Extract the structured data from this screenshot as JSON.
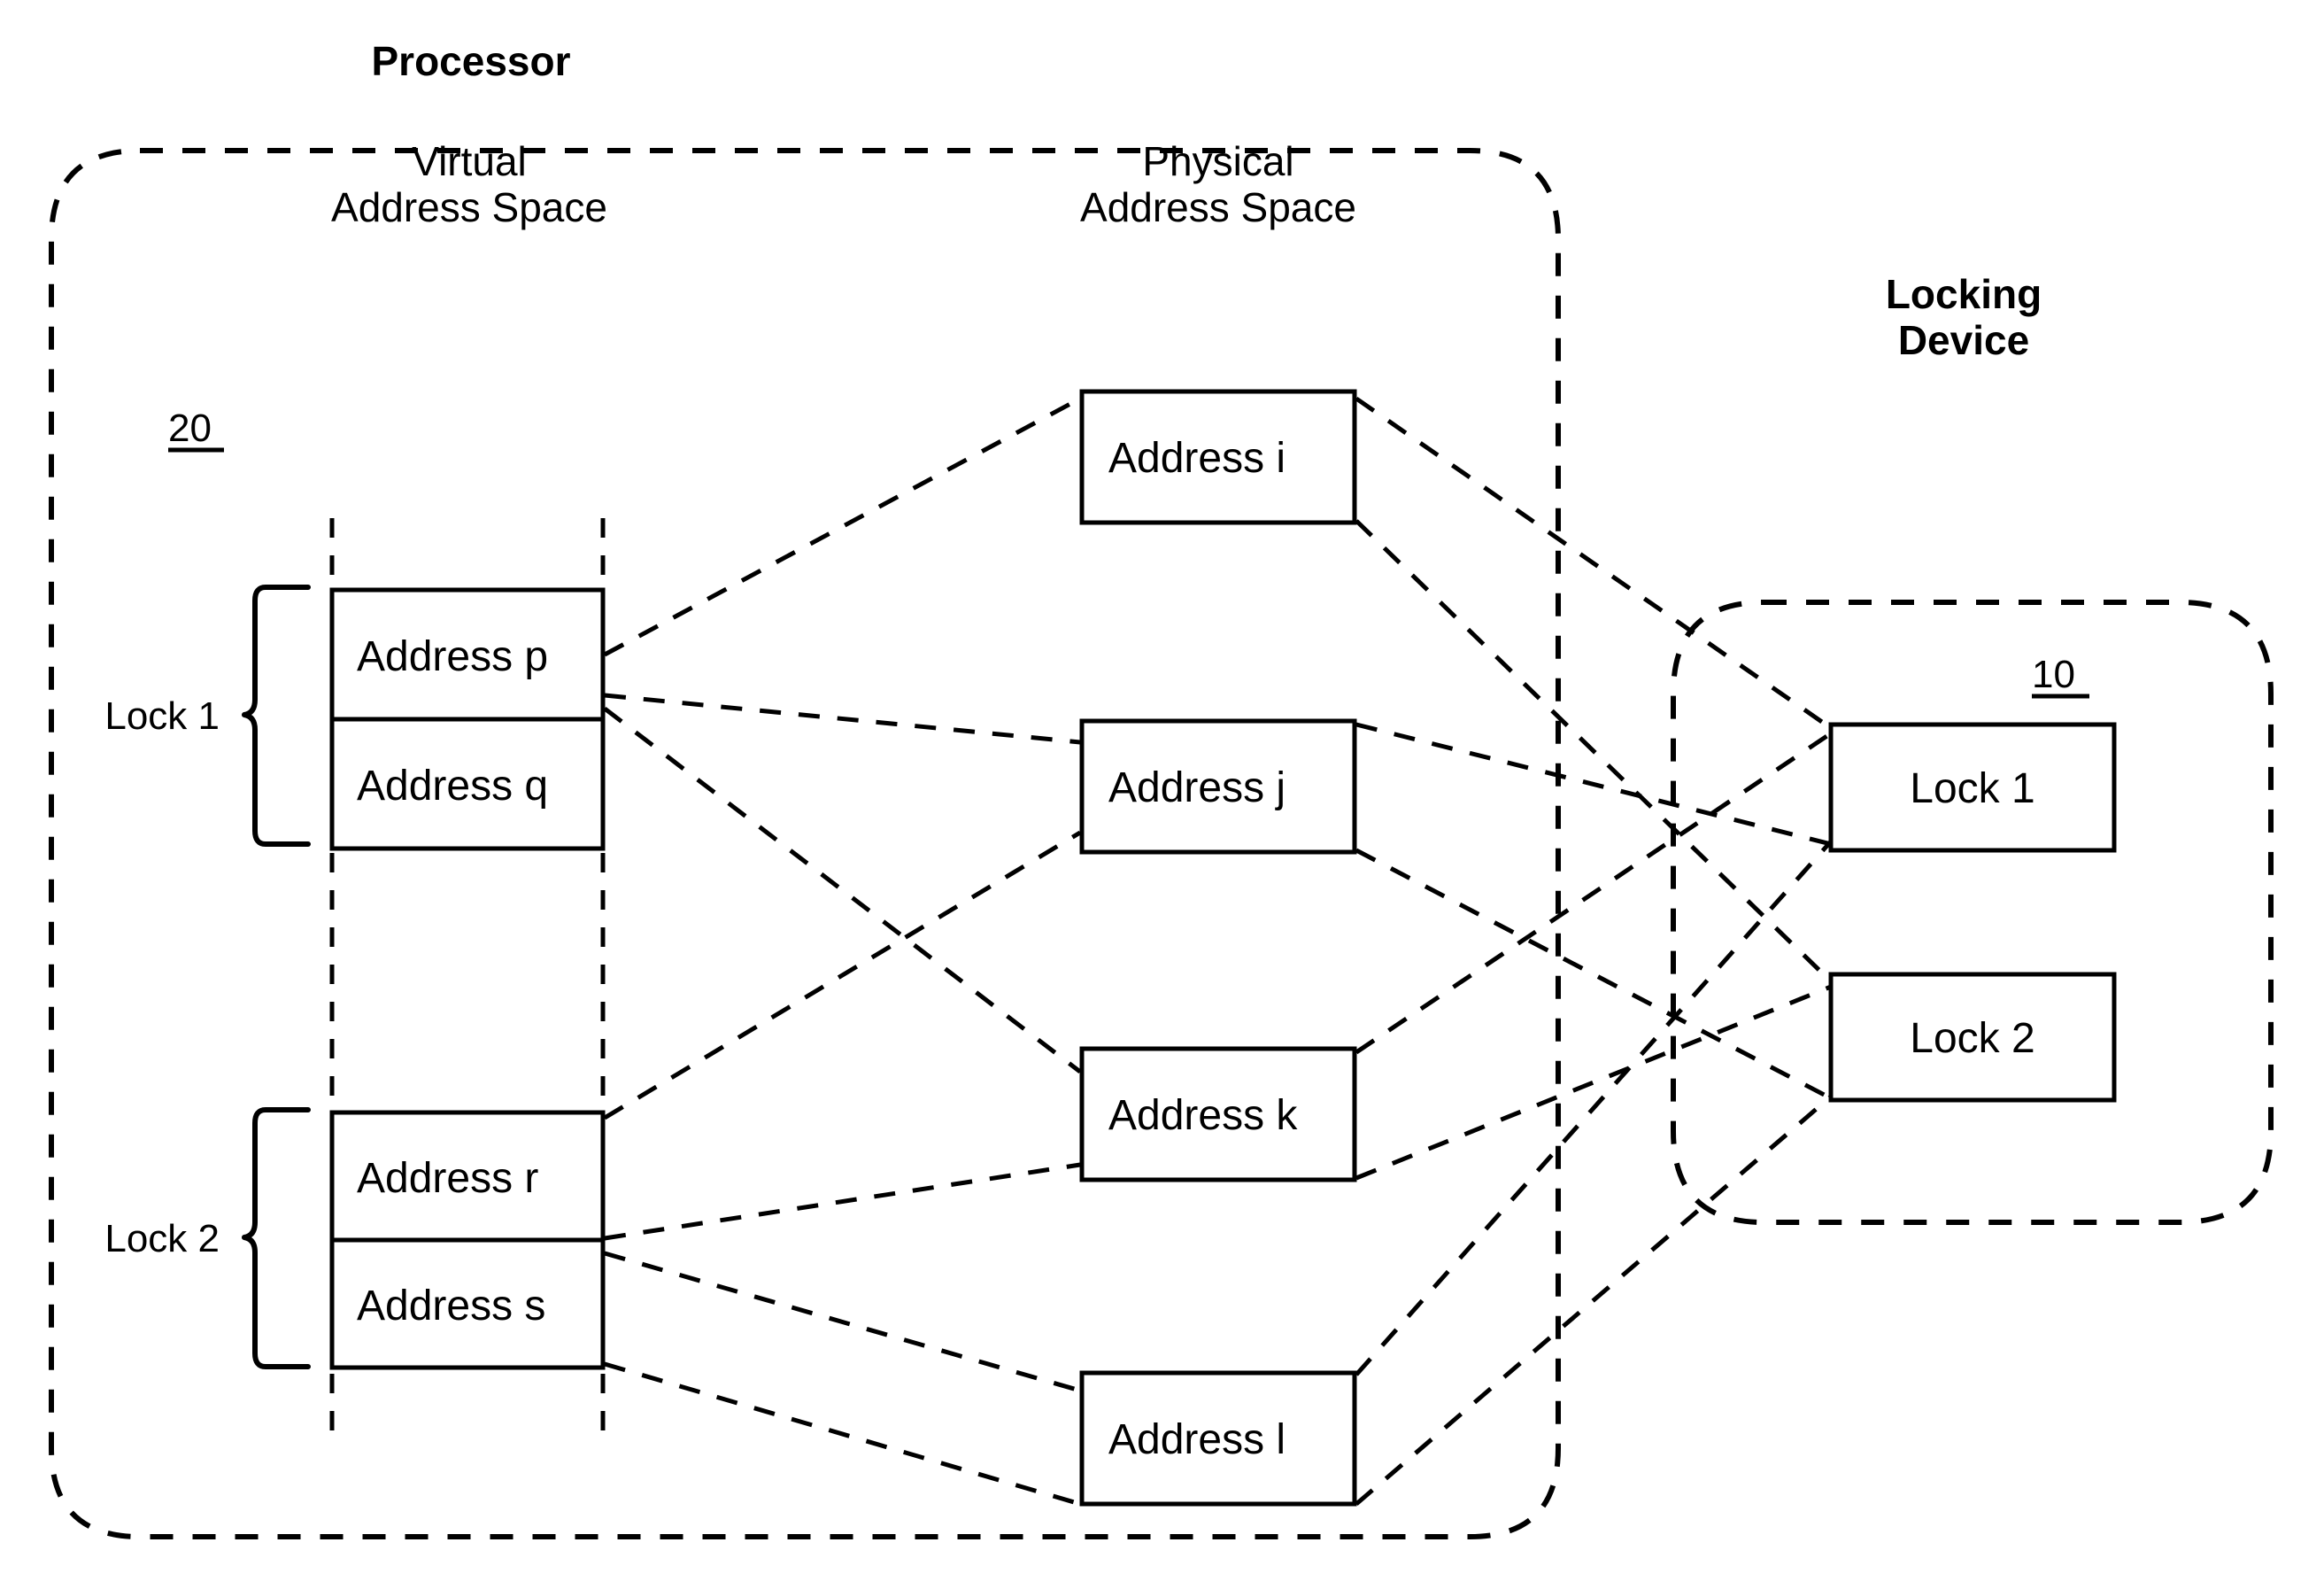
{
  "figure": {
    "kind": "patent-diagram",
    "background_color": "#ffffff",
    "line_color": "#000000"
  },
  "processor": {
    "title": "Processor",
    "reference_numeral": "20",
    "virtual_space": {
      "header_line1": "Virtual",
      "header_line2": "Address Space",
      "groups": [
        {
          "brace_label": "Lock 1",
          "addresses": [
            "Address p",
            "Address q"
          ]
        },
        {
          "brace_label": "Lock 2",
          "addresses": [
            "Address r",
            "Address s"
          ]
        }
      ]
    },
    "physical_space": {
      "header_line1": "Physical",
      "header_line2": "Address Space",
      "addresses": [
        "Address i",
        "Address j",
        "Address k",
        "Address l"
      ]
    }
  },
  "locking_device": {
    "title_line1": "Locking",
    "title_line2": "Device",
    "reference_numeral": "10",
    "locks": [
      "Lock 1",
      "Lock 2"
    ]
  }
}
